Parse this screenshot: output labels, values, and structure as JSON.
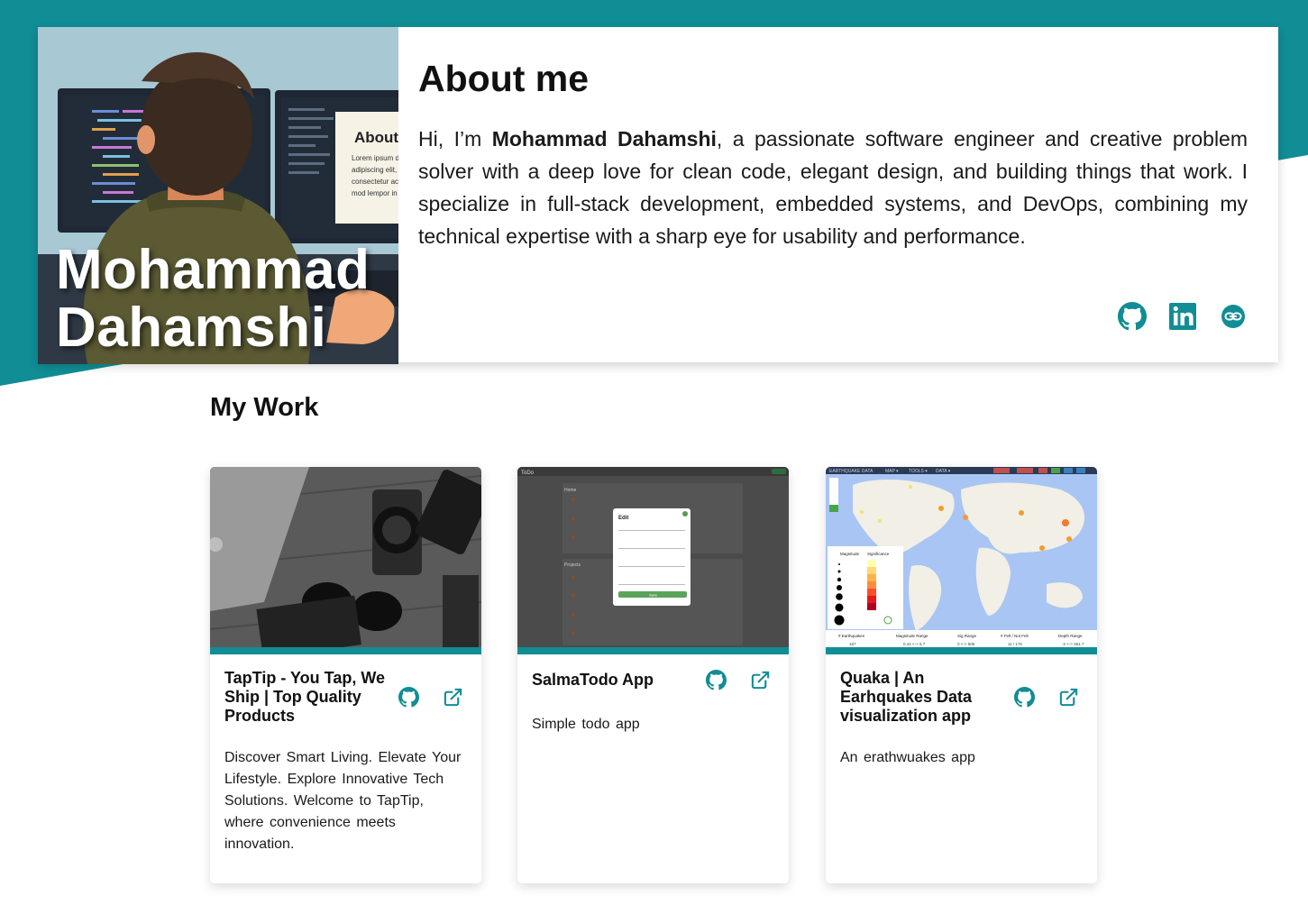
{
  "colors": {
    "teal": "#108d95",
    "text": "#111111"
  },
  "hero": {
    "name_line1": "Mohammad",
    "name_line2": "Dahamshi",
    "illustration_screen_title": "About",
    "illustration_screen_lines": [
      "Lorem ipsum d",
      "adipiscing elit,",
      "consectetur ac",
      "mod lempor in"
    ]
  },
  "about": {
    "title": "About me",
    "intro_pre": "Hi, I’m ",
    "intro_name": "Mohammad Dahamshi",
    "intro_post": ", a passionate software engineer and creative problem solver with a deep love for clean code, elegant design, and building things that work. I specialize in full-stack development, embedded systems, and DevOps, combining my technical expertise with a sharp eye for usability and performance."
  },
  "social": [
    {
      "icon": "github-icon"
    },
    {
      "icon": "linkedin-icon"
    },
    {
      "icon": "link-icon"
    }
  ],
  "work": {
    "title": "My Work",
    "projects": [
      {
        "title": "TapTip - You Tap, We Ship | Top Quality Products",
        "description": "Discover Smart Living. Elevate Your Lifestyle. Explore Innovative Tech Solutions. Welcome to TapTip, where convenience meets innovation.",
        "icons": [
          "github-icon",
          "external-link-icon"
        ]
      },
      {
        "title": "SalmaTodo App",
        "description": "Simple todo app",
        "icons": [
          "github-icon",
          "external-link-icon"
        ],
        "screenshot": {
          "app_name": "ToDo",
          "section_home": "Home",
          "section_projects": "Projects",
          "modal_title": "Edit",
          "modal_button": "Save"
        }
      },
      {
        "title": "Quaka | An Earhquakes Data visualization app",
        "description": "An erathwuakes app",
        "icons": [
          "github-icon",
          "external-link-icon"
        ],
        "screenshot": {
          "menu": [
            "EARTHQUAKE DATA",
            "MAP ▾",
            "TOOLS ▾",
            "DATA ▾"
          ],
          "legend_magnitude": "Magnitude",
          "legend_significance": "Significance",
          "stats_headers": [
            "# Earthquakes",
            "Magnitude Range",
            "Sig Range",
            "# Felt / Not Felt",
            "Depth Range"
          ],
          "stats_values": [
            "167",
            "0.44 <-> 5.7",
            "0 <-> 505",
            "11 / 176",
            "-2 <-> 561.7"
          ]
        }
      }
    ]
  }
}
